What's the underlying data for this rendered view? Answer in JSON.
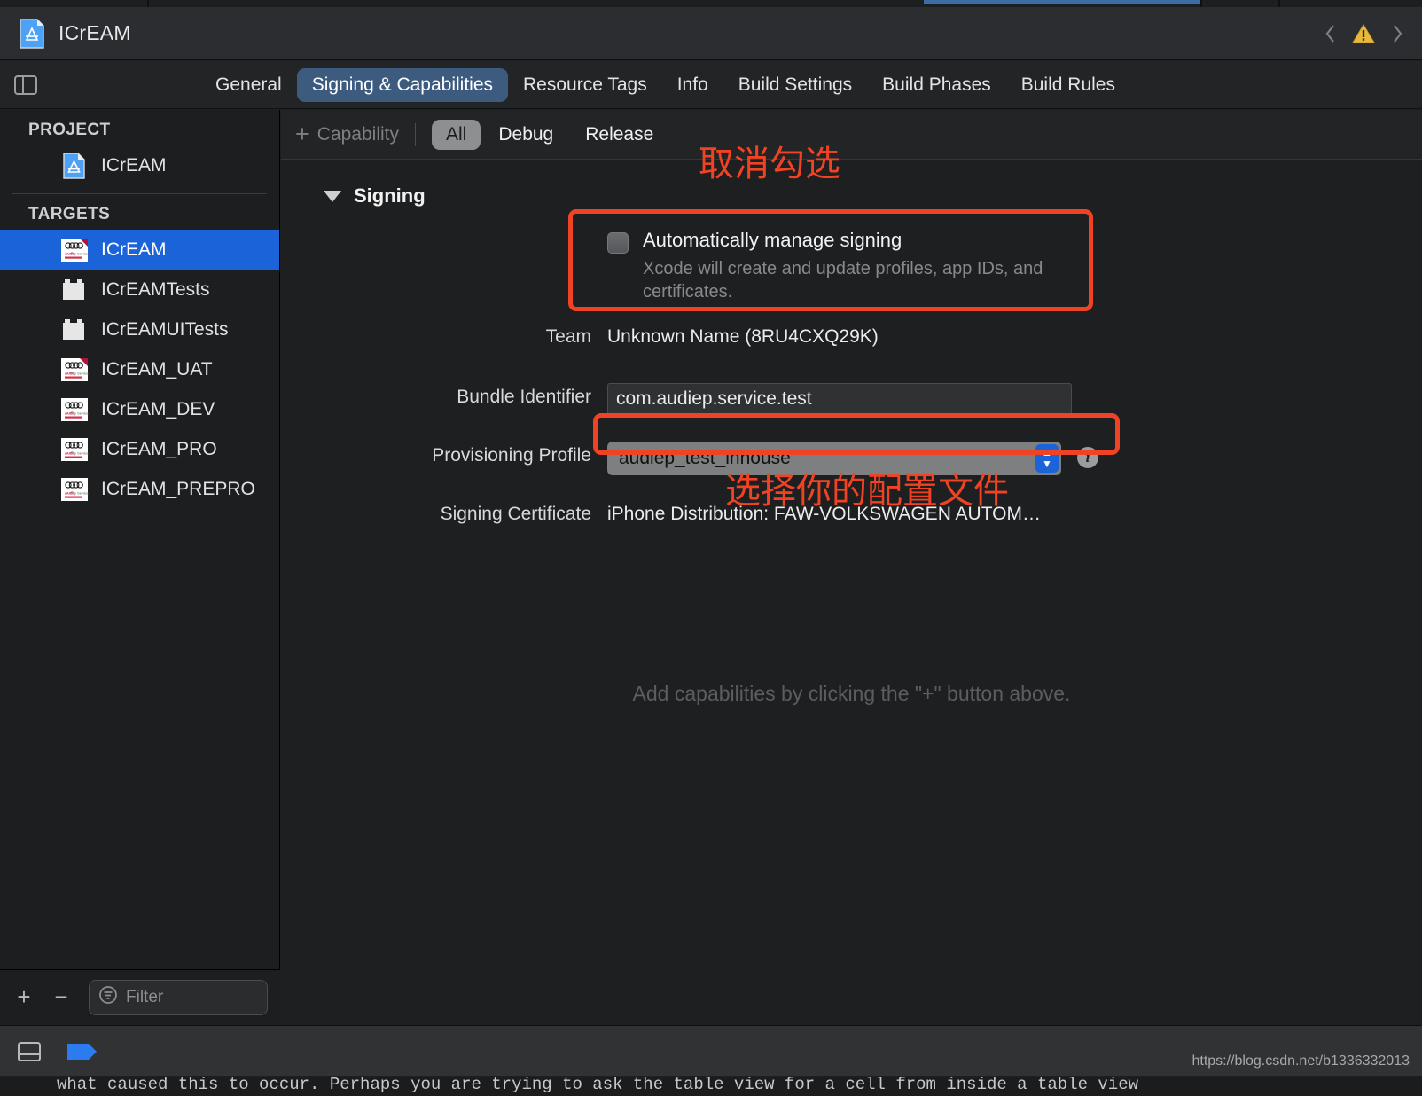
{
  "window": {
    "title": "ICrEAM",
    "doc_icon": "app-project-icon",
    "nav_back_icon": "chevron-left-icon",
    "warning_icon": "warning-triangle-icon",
    "nav_forward_icon": "chevron-right-icon"
  },
  "tabbar": {
    "panel_toggle_icon": "sidebar-toggle-icon",
    "tabs": [
      {
        "label": "General",
        "active": false
      },
      {
        "label": "Signing & Capabilities",
        "active": true
      },
      {
        "label": "Resource Tags",
        "active": false
      },
      {
        "label": "Info",
        "active": false
      },
      {
        "label": "Build Settings",
        "active": false
      },
      {
        "label": "Build Phases",
        "active": false
      },
      {
        "label": "Build Rules",
        "active": false
      }
    ],
    "active_tab_color": "#3d5b7e"
  },
  "sidebar": {
    "project_header": "PROJECT",
    "project_items": [
      {
        "label": "ICrEAM",
        "icon": "xcode-project-icon"
      }
    ],
    "targets_header": "TARGETS",
    "target_items": [
      {
        "label": "ICrEAM",
        "icon": "audi-app-icon",
        "selected": true
      },
      {
        "label": "ICrEAMTests",
        "icon": "test-bundle-icon",
        "selected": false
      },
      {
        "label": "ICrEAMUITests",
        "icon": "test-bundle-icon",
        "selected": false
      },
      {
        "label": "ICrEAM_UAT",
        "icon": "audi-app-icon",
        "selected": false
      },
      {
        "label": "ICrEAM_DEV",
        "icon": "audi-app-icon",
        "selected": false
      },
      {
        "label": "ICrEAM_PRO",
        "icon": "audi-app-icon",
        "selected": false
      },
      {
        "label": "ICrEAM_PREPRO",
        "icon": "audi-app-icon",
        "selected": false
      }
    ],
    "selection_color": "#1a63d8",
    "footer": {
      "add_label": "+",
      "remove_label": "−",
      "filter_placeholder": "Filter",
      "filter_icon": "filter-icon"
    }
  },
  "capability_bar": {
    "add_capability_label": "Capability",
    "add_capability_plus": "+",
    "segments": [
      {
        "label": "All",
        "active": true
      },
      {
        "label": "Debug",
        "active": false
      },
      {
        "label": "Release",
        "active": false
      }
    ]
  },
  "signing": {
    "section_title": "Signing",
    "disclosure_icon": "triangle-down-icon",
    "auto_manage": {
      "title": "Automatically manage signing",
      "subtitle": "Xcode will create and update profiles, app IDs, and certificates.",
      "checked": false
    },
    "fields": [
      {
        "label": "Team",
        "value": "Unknown Name (8RU4CXQ29K)",
        "kind": "static"
      },
      {
        "label": "Bundle Identifier",
        "value": "com.audiep.service.test",
        "kind": "textfield"
      },
      {
        "label": "Provisioning Profile",
        "value": "audiep_test_inhouse",
        "kind": "popup"
      },
      {
        "label": "Signing Certificate",
        "value": "iPhone Distribution: FAW-VOLKSWAGEN AUTOM…",
        "kind": "static"
      }
    ],
    "info_icon": "info-circle-icon",
    "stepper_icon": "updown-stepper-icon"
  },
  "empty_state": {
    "message": "Add capabilities by clicking the \"+\" button above."
  },
  "annotations": {
    "accent_color": "#f04323",
    "uncheck_note": "取消勾选",
    "select_profile_note": "选择你的配置文件"
  },
  "status_bar": {
    "panel_icon": "bottom-panel-toggle-icon",
    "tag_icon": "blue-tag-icon",
    "watermark": "https://blog.csdn.net/b1336332013"
  },
  "console": {
    "text": "what caused this to occur.  Perhaps you are trying to ask the table view for a cell from inside a table view"
  }
}
